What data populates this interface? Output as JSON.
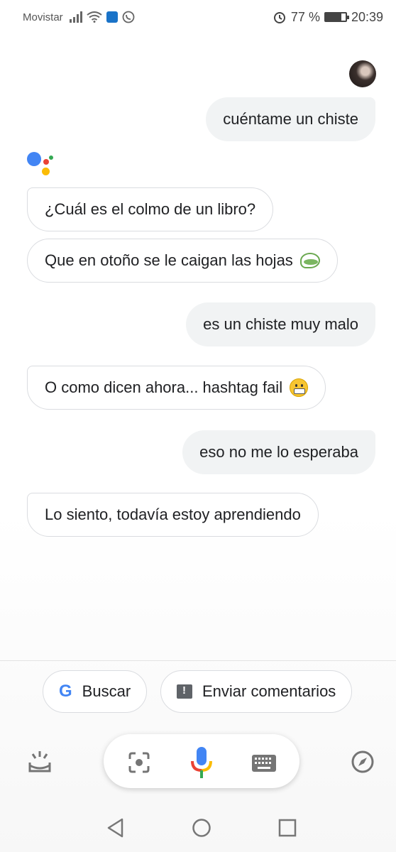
{
  "status_bar": {
    "carrier": "Movistar",
    "battery": "77 %",
    "time": "20:39",
    "battery_level": 0.77
  },
  "conversation": [
    {
      "role": "user",
      "text": "cuéntame un chiste"
    },
    {
      "role": "assistant",
      "text": "¿Cuál es el colmo de un libro?"
    },
    {
      "role": "assistant",
      "text": "Que en otoño se le caigan las hojas",
      "emoji": "leaf"
    },
    {
      "role": "user",
      "text": "es un chiste muy malo"
    },
    {
      "role": "assistant",
      "text": "O como dicen ahora... hashtag fail",
      "emoji": "grimacing"
    },
    {
      "role": "user",
      "text": "eso no me lo esperaba"
    },
    {
      "role": "assistant",
      "text": "Lo siento, todavía estoy aprendiendo"
    }
  ],
  "suggestions": {
    "search_label": "Buscar",
    "feedback_label": "Enviar comentarios"
  },
  "icons": {
    "google": "G",
    "updates": "updates-tray-icon",
    "lens": "lens-icon",
    "mic": "mic-icon",
    "keyboard": "keyboard-icon",
    "explore": "compass-icon"
  },
  "colors": {
    "blue": "#4285f4",
    "red": "#ea4335",
    "yellow": "#fbbc05",
    "green": "#34a853"
  }
}
